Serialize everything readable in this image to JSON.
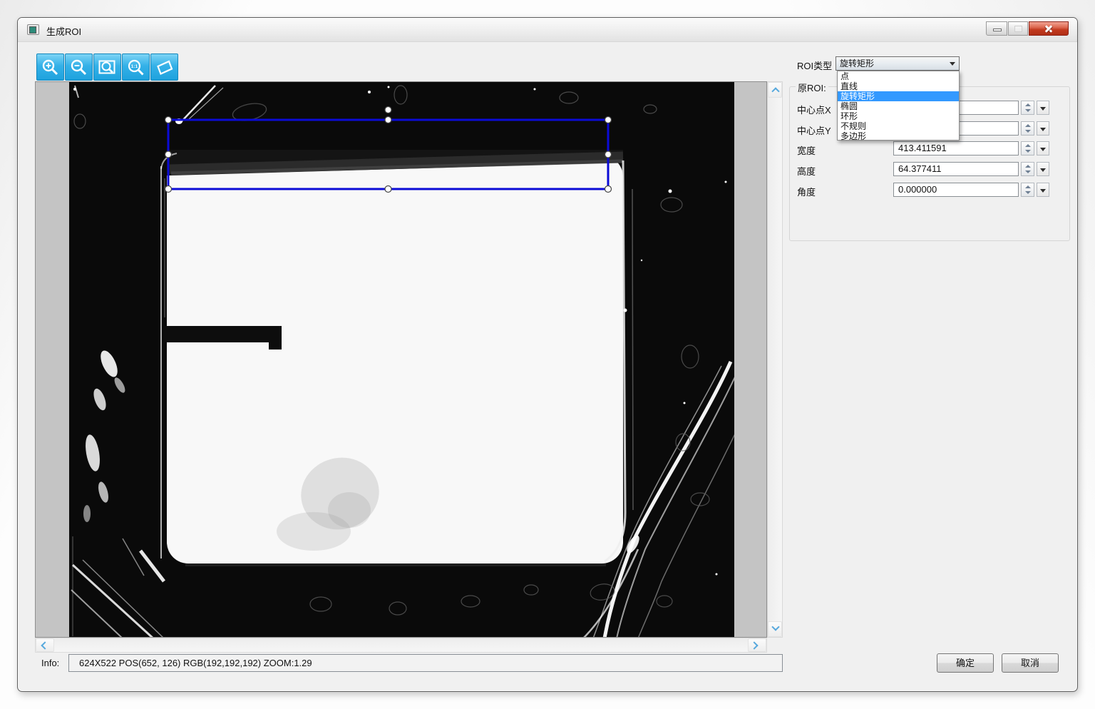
{
  "window": {
    "title": "生成ROI"
  },
  "toolbar": {
    "zoom_in": "zoom-in",
    "zoom_out": "zoom-out",
    "zoom_fit": "zoom-fit",
    "actual_size_label": "1:1",
    "roi_tool": "rotated-rect-tool"
  },
  "roi": {
    "type_label": "ROI类型",
    "type_value": "旋转矩形",
    "options": [
      {
        "label": "点",
        "selected": false
      },
      {
        "label": "直线",
        "selected": false
      },
      {
        "label": "旋转矩形",
        "selected": true
      },
      {
        "label": "椭圆",
        "selected": false
      },
      {
        "label": "环形",
        "selected": false
      },
      {
        "label": "不规则",
        "selected": false
      },
      {
        "label": "多边形",
        "selected": false
      }
    ],
    "group_label": "原ROI:",
    "fields": [
      {
        "label": "中心点X",
        "value": ""
      },
      {
        "label": "中心点Y",
        "value": ""
      },
      {
        "label": "宽度",
        "value": "413.411591"
      },
      {
        "label": "高度",
        "value": "64.377411"
      },
      {
        "label": "角度",
        "value": "0.000000"
      }
    ]
  },
  "status": {
    "info_label": "Info:",
    "info_text": "624X522  POS(652, 126)  RGB(192,192,192)  ZOOM:1.29"
  },
  "actions": {
    "ok": "确定",
    "cancel": "取消"
  },
  "colors": {
    "toolbar_cyan": "#35b1e8",
    "selection_blue": "#3399ff",
    "roi_blue": "#0b0bd6",
    "close_red": "#c23a1f",
    "viewer_gray": "#c0c0c0"
  }
}
